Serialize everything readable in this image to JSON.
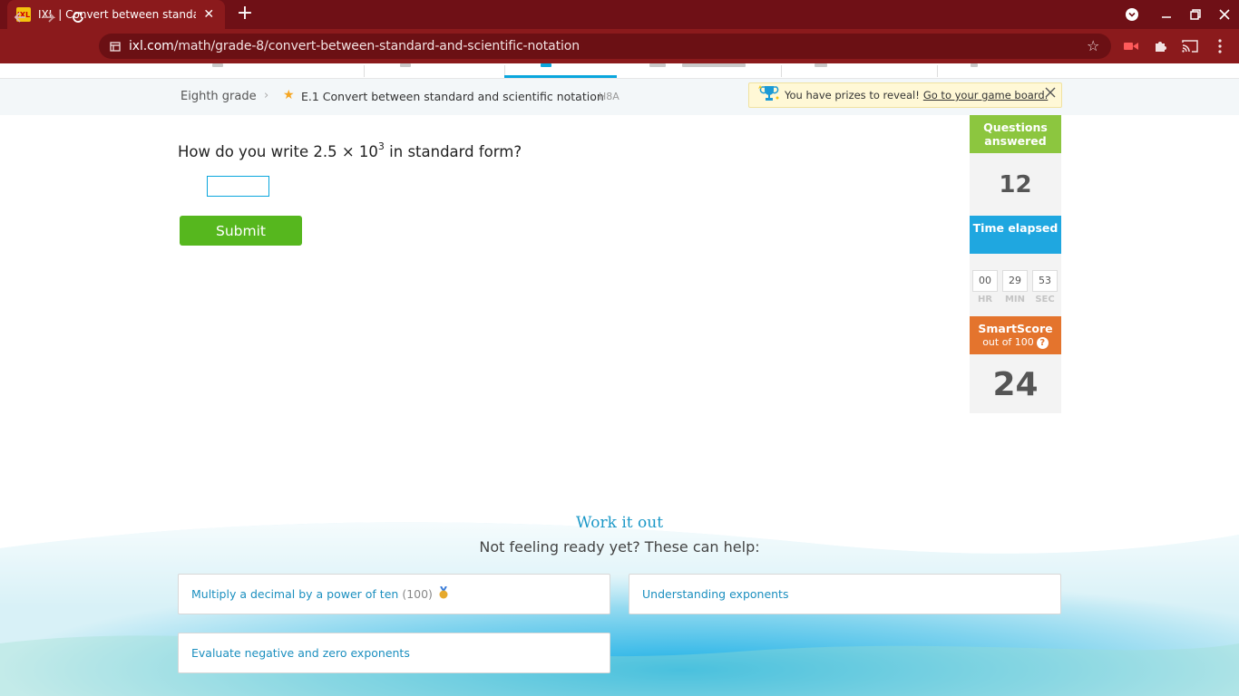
{
  "browser": {
    "tab_title": "IXL | Convert between standard a",
    "favicon_text": "IXL",
    "url_host": "ixl.com",
    "url_path": "/math/grade-8/convert-between-standard-and-scientific-notation"
  },
  "breadcrumb": {
    "grade": "Eighth grade",
    "skill": "E.1 Convert between standard and scientific notation",
    "code": "H8A"
  },
  "prize": {
    "text": "You have prizes to reveal!",
    "link": "Go to your game board."
  },
  "question": {
    "prefix": "How do you write 2.5 × 10",
    "exponent": "3",
    "suffix": " in standard form?"
  },
  "answer": {
    "value": "",
    "placeholder": ""
  },
  "submit_label": "Submit",
  "stats": {
    "questions_label": "Questions answered",
    "questions_value": "12",
    "time_label": "Time elapsed",
    "hours": "00",
    "minutes": "29",
    "seconds": "53",
    "hr_label": "HR",
    "min_label": "MIN",
    "sec_label": "SEC",
    "smartscore_label": "SmartScore",
    "smartscore_sub": "out of 100",
    "smartscore_help": "?",
    "smartscore_value": "24"
  },
  "work_it_out": {
    "title": "Work it out",
    "subtitle": "Not feeling ready yet? These can help:",
    "cards": [
      {
        "label": "Multiply a decimal by a power of ten",
        "score": "(100)"
      },
      {
        "label": "Understanding exponents"
      },
      {
        "label": "Evaluate negative and zero exponents"
      }
    ]
  },
  "colors": {
    "chrome": "#8b1a1c",
    "questions_head": "#8cc63f",
    "time_head": "#1fa7e0",
    "smartscore_head": "#e4742d",
    "submit": "#56b71e",
    "accent_blue": "#1b98c7"
  }
}
